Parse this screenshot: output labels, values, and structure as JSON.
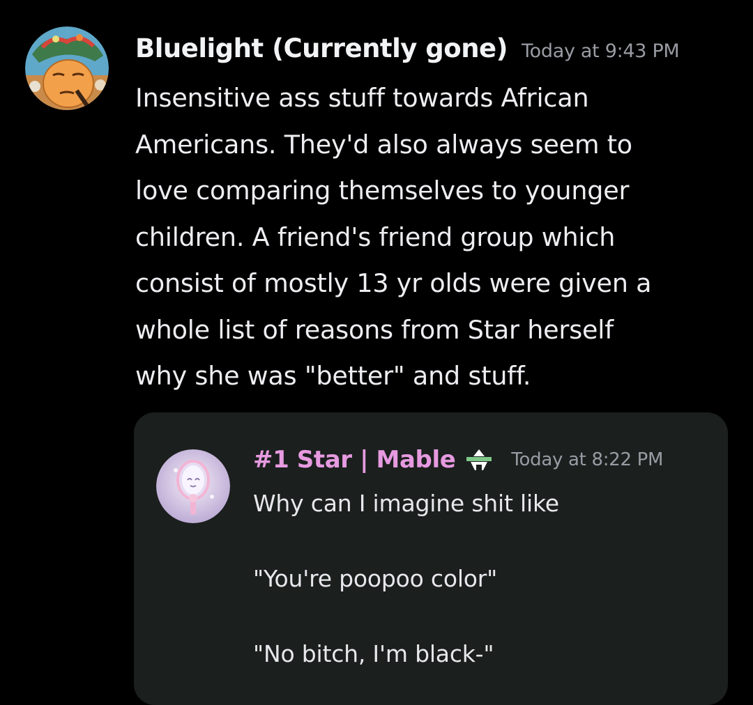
{
  "message": {
    "author": "Bluelight (Currently gone)",
    "timestamp": "Today at 9:43 PM",
    "lines": [
      "Insensitive ass stuff towards African",
      "Americans. They'd also always seem to",
      "love comparing themselves to younger",
      "children. A friend's friend group which",
      "consist of mostly 13 yr olds were given a",
      "whole list of reasons from Star herself",
      "why she was \"better\" and stuff."
    ],
    "avatar_icon": "cartoon-character-avatar"
  },
  "quoted": {
    "author": "#1 Star | Mable",
    "timestamp": "Today at 8:22 PM",
    "role_icon": "role-badge-icon",
    "lines": [
      "Why can I imagine shit like",
      "",
      "\"You're poopoo color\"",
      "",
      "\"No bitch, I'm black-\""
    ],
    "avatar_icon": "hand-mirror-avatar",
    "author_color": "#e69ae0"
  },
  "colors": {
    "background": "#000000",
    "embed_background": "#1b1f1e",
    "text": "#eeeef2",
    "muted": "#9a9ca4"
  }
}
